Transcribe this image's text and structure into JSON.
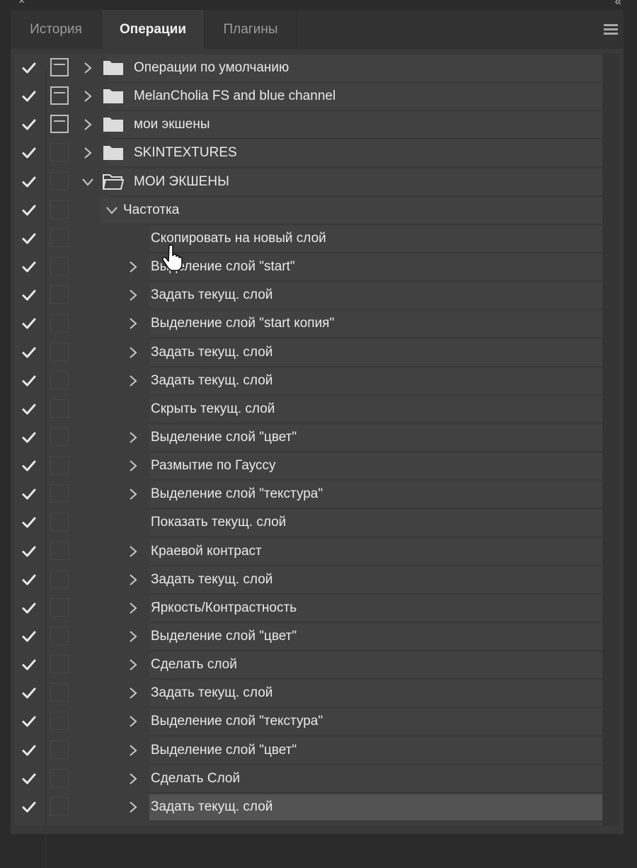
{
  "window": {
    "close_glyph": "×",
    "collapse_glyph": "«"
  },
  "tabs": [
    {
      "label": "История",
      "active": false
    },
    {
      "label": "Операции",
      "active": true
    },
    {
      "label": "Плагины",
      "active": false
    }
  ],
  "panel_menu_icon": "hamburger-menu-icon",
  "colors": {
    "panel_bg": "#393939",
    "row_bg": "#414141",
    "selected_row_bg": "#535353",
    "text": "#e9e9e9",
    "inactive_tab_text": "#9b9b9b"
  },
  "actions_list": {
    "sets": [
      {
        "label": "Операции по умолчанию",
        "checked": true,
        "dialog": true,
        "expanded": false
      },
      {
        "label": "MelanCholia FS and blue channel",
        "checked": true,
        "dialog": true,
        "expanded": false
      },
      {
        "label": "мои экшены",
        "checked": true,
        "dialog": true,
        "expanded": false
      },
      {
        "label": "SKINTEXTURES",
        "checked": true,
        "dialog": false,
        "expanded": false
      },
      {
        "label": "МОИ ЭКШЕНЫ",
        "checked": true,
        "dialog": false,
        "expanded": true
      }
    ],
    "action": {
      "label": "Частотка",
      "checked": true,
      "expanded": true
    },
    "steps": [
      {
        "label": "Скопировать на новый слой",
        "expandable": false
      },
      {
        "label": "Выделение слой \"start\"",
        "expandable": true
      },
      {
        "label": "Задать текущ. слой",
        "expandable": true
      },
      {
        "label": "Выделение слой \"start копия\"",
        "expandable": true
      },
      {
        "label": "Задать текущ. слой",
        "expandable": true
      },
      {
        "label": "Задать текущ. слой",
        "expandable": true
      },
      {
        "label": "Скрыть текущ. слой",
        "expandable": false
      },
      {
        "label": "Выделение слой \"цвет\"",
        "expandable": true
      },
      {
        "label": "Размытие по Гауссу",
        "expandable": true
      },
      {
        "label": "Выделение слой \"текстура\"",
        "expandable": true
      },
      {
        "label": "Показать текущ. слой",
        "expandable": false
      },
      {
        "label": "Краевой контраст",
        "expandable": true
      },
      {
        "label": "Задать текущ. слой",
        "expandable": true
      },
      {
        "label": "Яркость/Контрастность",
        "expandable": true
      },
      {
        "label": "Выделение слой \"цвет\"",
        "expandable": true
      },
      {
        "label": "Сделать слой",
        "expandable": true
      },
      {
        "label": "Задать текущ. слой",
        "expandable": true
      },
      {
        "label": "Выделение слой \"текстура\"",
        "expandable": true
      },
      {
        "label": "Выделение слой \"цвет\"",
        "expandable": true
      },
      {
        "label": "Сделать Слой",
        "expandable": true
      },
      {
        "label": "Задать текущ. слой",
        "expandable": true,
        "selected": true
      }
    ]
  }
}
